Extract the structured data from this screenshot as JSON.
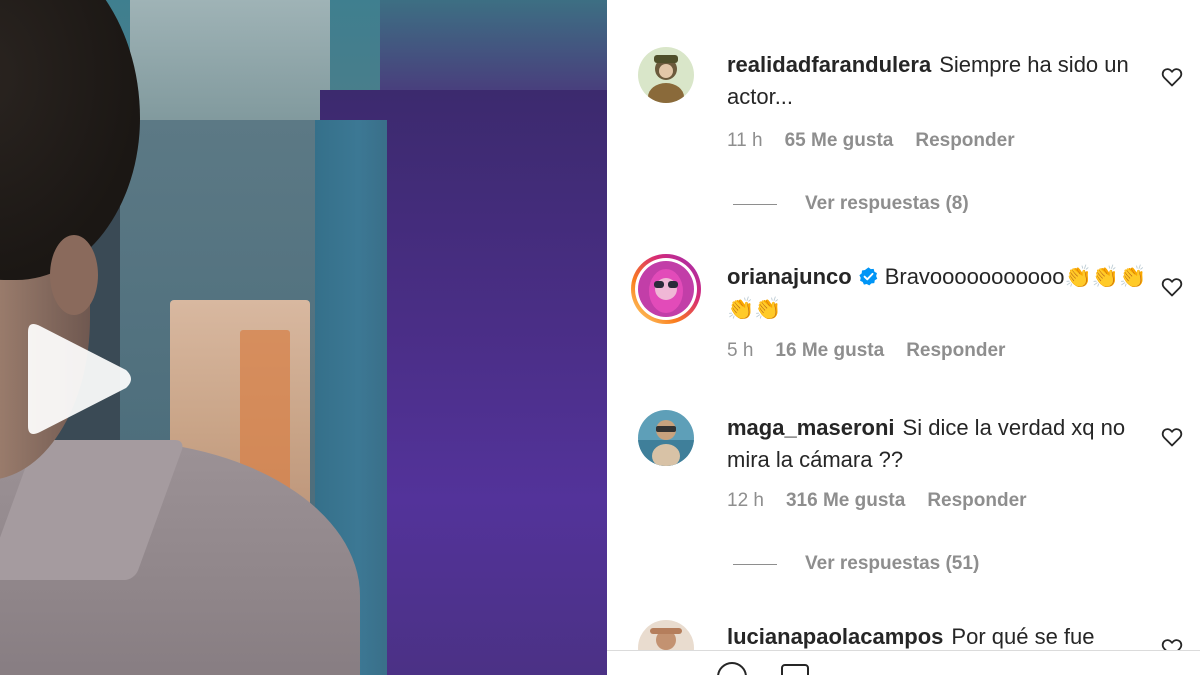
{
  "comments": [
    {
      "username": "realidadfarandulera",
      "text": "Siempre ha sido un actor...",
      "time": "11 h",
      "likes": "65 Me gusta",
      "reply": "Responder",
      "view_replies": "Ver respuestas (8)"
    },
    {
      "username": "orianajunco",
      "verified": true,
      "text": "Bravooooooooooo👏👏👏👏👏",
      "time": "5 h",
      "likes": "16 Me gusta",
      "reply": "Responder"
    },
    {
      "username": "maga_maseroni",
      "text": "Si dice la verdad xq no mira la cámara ??",
      "time": "12 h",
      "likes": "316 Me gusta",
      "reply": "Responder",
      "view_replies": "Ver respuestas (51)"
    },
    {
      "username": "lucianapaolacampos",
      "text": "Por qué se fue"
    }
  ],
  "video": {
    "play_icon": "play-icon"
  },
  "colors": {
    "text": "#262626",
    "muted": "#8e8e8e",
    "verified": "#0095f6"
  }
}
